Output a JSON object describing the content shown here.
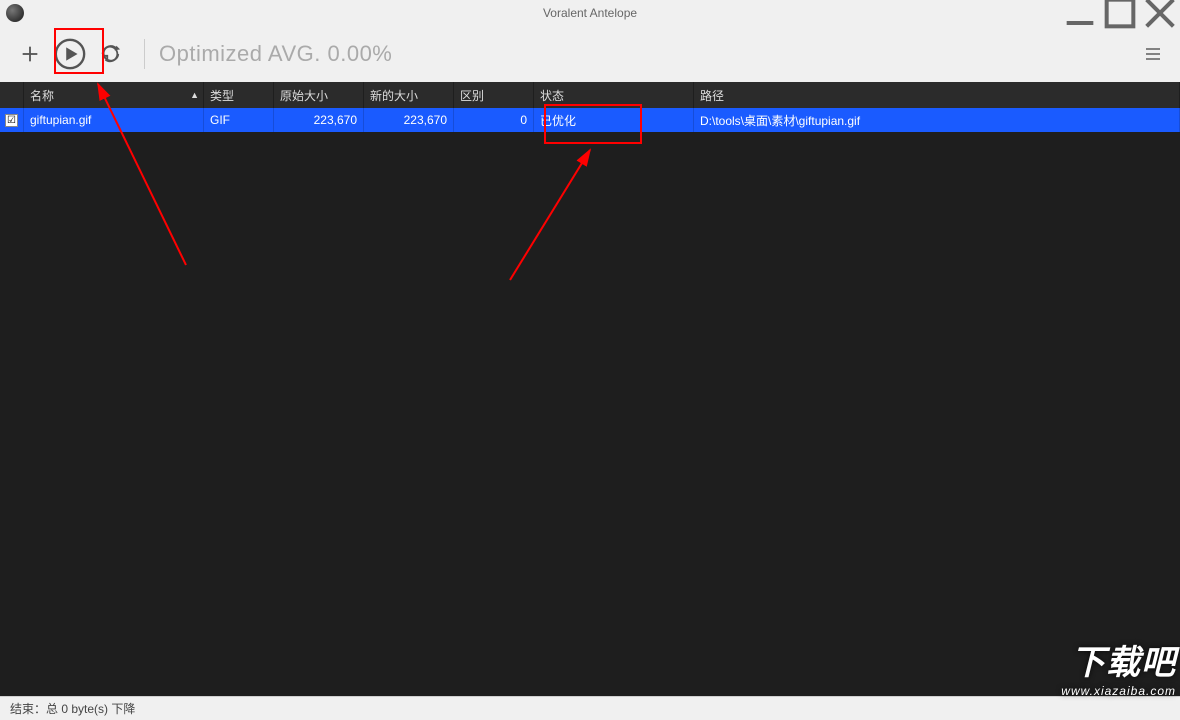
{
  "title": "Voralent Antelope",
  "toolbar": {
    "avg_text": "Optimized AVG. 0.00%"
  },
  "columns": {
    "name": "名称",
    "type": "类型",
    "original_size": "原始大小",
    "new_size": "新的大小",
    "diff": "区别",
    "status": "状态",
    "path": "路径"
  },
  "rows": [
    {
      "checked": "☑",
      "name": "giftupian.gif",
      "type": "GIF",
      "original_size": "223,670",
      "new_size": "223,670",
      "diff": "0",
      "status": "已优化",
      "path": "D:\\tools\\桌面\\素材\\giftupian.gif"
    }
  ],
  "statusbar": "结束：总 0 byte(s) 下降",
  "watermark": {
    "big": "下载吧",
    "small": "www.xiazaiba.com"
  }
}
